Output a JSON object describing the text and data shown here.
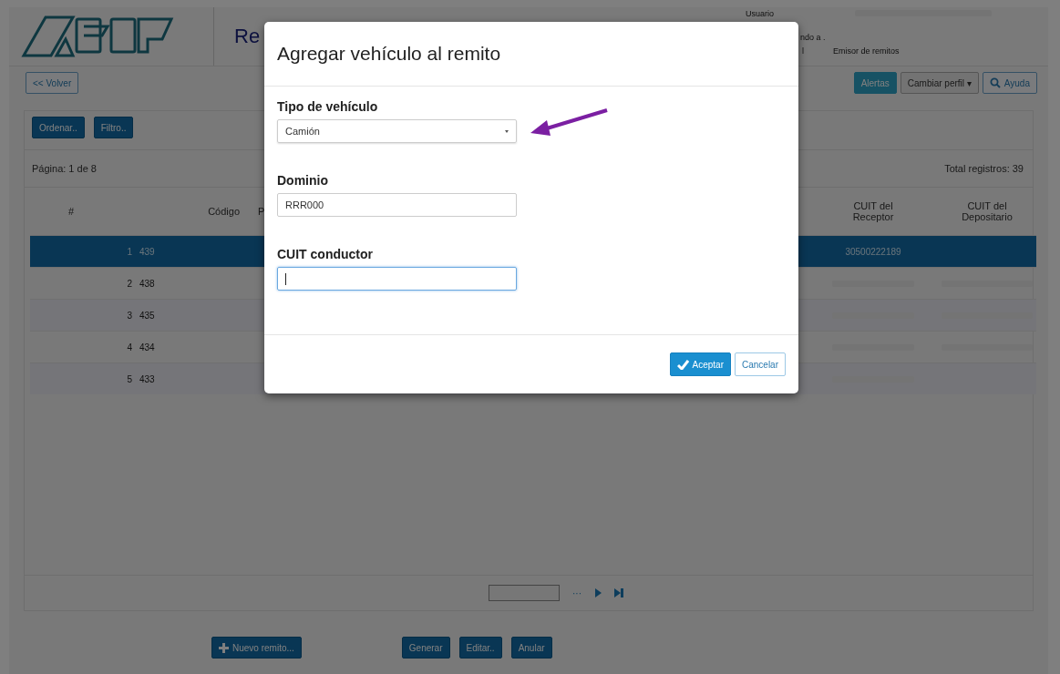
{
  "header": {
    "title_fragment": "Re",
    "user_label": "Usuario",
    "user_line2_fragment": "ndo a .",
    "user_line3_fragment": "l",
    "profile": "Emisor de remitos"
  },
  "toolbar": {
    "back": "<< Volver",
    "alerts": "Alertas",
    "change_profile": "Cambiar perfil",
    "change_profile_caret": "▾",
    "help": "Ayuda"
  },
  "filters": [
    "Ordenar..",
    "Filtro.."
  ],
  "page_info": "Página:  1 de 8",
  "total": "Total registros:  39",
  "columns": [
    "#",
    "Código",
    "P",
    "CUIT del Receptor",
    "CUIT del Depositario"
  ],
  "rows": [
    {
      "num": "1",
      "code": "439",
      "receptor": "30500222189",
      "receptor_masked": false,
      "depositario_masked": false,
      "selected": true
    },
    {
      "num": "2",
      "code": "438",
      "receptor_masked": true,
      "depositario_masked": true,
      "selected": false
    },
    {
      "num": "3",
      "code": "435",
      "receptor_masked": true,
      "depositario_masked": true,
      "selected": false
    },
    {
      "num": "4",
      "code": "434",
      "receptor_masked": true,
      "depositario_masked": true,
      "selected": false
    },
    {
      "num": "5",
      "code": "433",
      "receptor_masked": true,
      "depositario_masked": false,
      "selected": false
    }
  ],
  "pager": {
    "more": "···"
  },
  "actions": [
    {
      "label": "Nuevo remito...",
      "kind": "add"
    },
    {
      "label": "Generar",
      "kind": "plain"
    },
    {
      "label": "Editar..",
      "kind": "plain"
    },
    {
      "label": "Anular",
      "kind": "plain"
    }
  ],
  "modal": {
    "title": "Agregar vehículo al remito",
    "fields": [
      {
        "label": "Tipo de vehículo",
        "kind": "select",
        "value": "Camión",
        "focused": false
      },
      {
        "label": "Dominio",
        "kind": "text",
        "value": "RRR000",
        "focused": false
      },
      {
        "label": "CUIT conductor",
        "kind": "text",
        "focused": true
      }
    ],
    "ok": "Aceptar",
    "cancel": "Cancelar"
  }
}
